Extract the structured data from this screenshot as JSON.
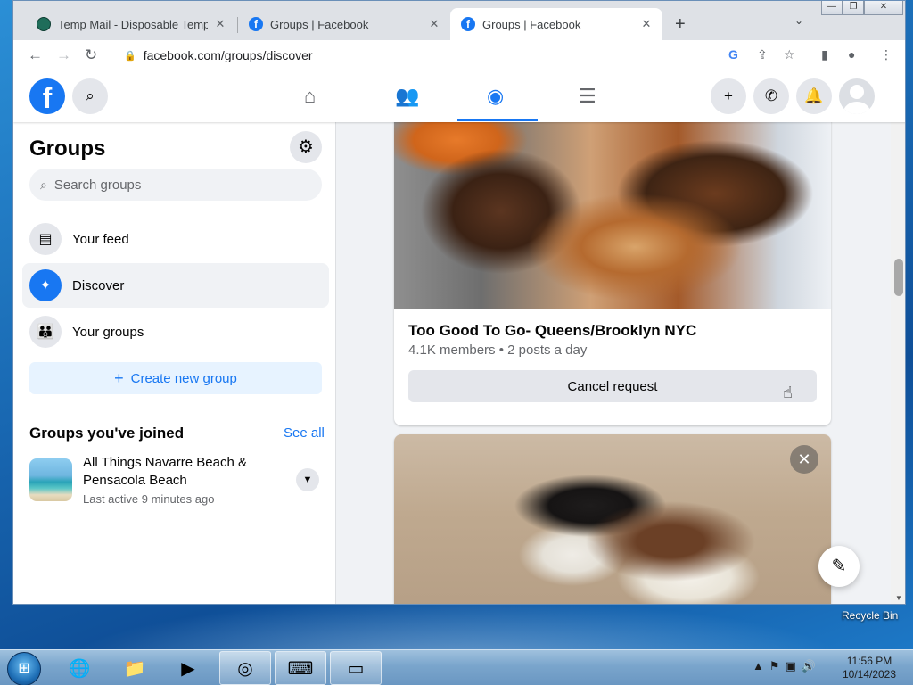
{
  "browser": {
    "tabs": [
      {
        "title": "Temp Mail - Disposable Tempora",
        "active": false
      },
      {
        "title": "Groups | Facebook",
        "active": false
      },
      {
        "title": "Groups | Facebook",
        "active": true
      }
    ],
    "url": "facebook.com/groups/discover",
    "new_tab_icon": "plus-icon",
    "window_controls": [
      "minimize",
      "restore",
      "close"
    ]
  },
  "header": {
    "logo": "f",
    "nav_icons": [
      "home-icon",
      "friends-icon",
      "groups-icon",
      "menu-icon"
    ],
    "active_nav": "groups-icon",
    "right_icons": [
      "plus-icon",
      "messenger-icon",
      "bell-icon",
      "avatar"
    ]
  },
  "sidebar": {
    "title": "Groups",
    "search_placeholder": "Search groups",
    "items": [
      {
        "label": "Your feed",
        "icon": "feed-icon",
        "active": false
      },
      {
        "label": "Discover",
        "icon": "compass-icon",
        "active": true
      },
      {
        "label": "Your groups",
        "icon": "people-icon",
        "active": false
      }
    ],
    "create_button": "Create new group",
    "joined_title": "Groups you've joined",
    "see_all": "See all",
    "joined_groups": [
      {
        "name": "All Things Navarre Beach & Pensacola Beach",
        "meta": "Last active 9 minutes ago"
      }
    ]
  },
  "feed": {
    "cards": [
      {
        "title": "Too Good To Go- Queens/Brooklyn NYC",
        "meta": "4.1K members • 2 posts a day",
        "button": "Cancel request"
      },
      {
        "dismiss_icon": "close-icon"
      }
    ]
  },
  "desktop": {
    "recycle_bin_label": "Recycle Bin"
  },
  "taskbar": {
    "time": "11:56 PM",
    "date": "10/14/2023"
  },
  "colors": {
    "brand": "#1877f2",
    "link": "#1877f2",
    "text_primary": "#050505",
    "text_secondary": "#65676b"
  }
}
